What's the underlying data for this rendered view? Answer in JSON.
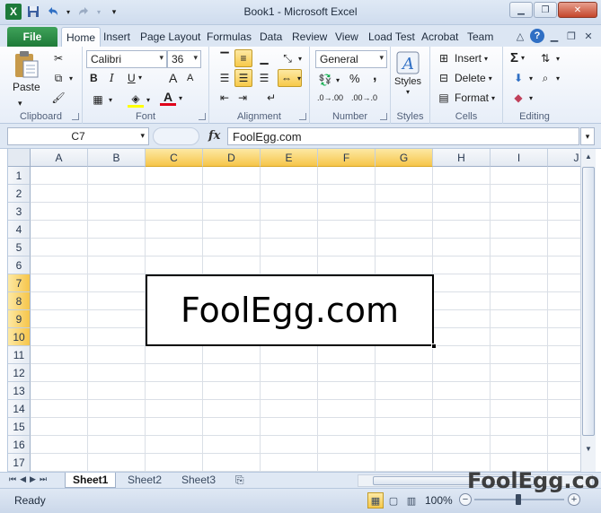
{
  "window": {
    "title": "Book1  -  Microsoft Excel"
  },
  "icons": {
    "app": "excel-icon",
    "save": "save-icon",
    "undo": "undo-icon",
    "redo": "redo-icon",
    "customize": "customize-qat-icon",
    "minimize": "minimize-icon",
    "restore": "restore-icon",
    "close": "close-icon",
    "help": "help-icon"
  },
  "qat": {
    "app_glyph": "X"
  },
  "ribbon_tabs": [
    "File",
    "Home",
    "Insert",
    "Page Layout",
    "Formulas",
    "Data",
    "Review",
    "View",
    "Load Test",
    "Acrobat",
    "Team"
  ],
  "active_tab": "Home",
  "groups": {
    "clipboard": {
      "label": "Clipboard",
      "paste": "Paste"
    },
    "font": {
      "label": "Font",
      "family": "Calibri",
      "size": "36",
      "bold": "B",
      "italic": "I",
      "underline": "U",
      "grow": "A",
      "shrink": "A",
      "color_glyph": "A"
    },
    "alignment": {
      "label": "Alignment"
    },
    "number": {
      "label": "Number",
      "format": "General",
      "percent": "%",
      "comma": ",",
      "inc_decimal": ".0→.00",
      "dec_decimal": ".00→.0"
    },
    "styles": {
      "label": "Styles",
      "button": "Styles"
    },
    "cells": {
      "label": "Cells",
      "insert": "Insert",
      "delete": "Delete",
      "format": "Format"
    },
    "editing": {
      "label": "Editing",
      "sum": "Σ"
    }
  },
  "formula_bar": {
    "name_box": "C7",
    "fx": "fx",
    "content": "FoolEgg.com"
  },
  "columns": [
    "A",
    "B",
    "C",
    "D",
    "E",
    "F",
    "G",
    "H",
    "I",
    "J"
  ],
  "selected_columns": [
    "C",
    "D",
    "E",
    "F",
    "G"
  ],
  "rows": [
    "1",
    "2",
    "3",
    "4",
    "5",
    "6",
    "7",
    "8",
    "9",
    "10",
    "11",
    "12",
    "13",
    "14",
    "15",
    "16",
    "17"
  ],
  "selected_rows": [
    "7",
    "8",
    "9",
    "10"
  ],
  "merged_cell": {
    "range": "C7:G10",
    "value": "FoolEgg.com"
  },
  "sheets": [
    "Sheet1",
    "Sheet2",
    "Sheet3"
  ],
  "active_sheet": "Sheet1",
  "status": {
    "mode": "Ready",
    "zoom": "100%",
    "zoom_minus": "−",
    "zoom_plus": "+"
  },
  "watermark": "FoolEgg.com",
  "colors": {
    "accent": "#f7c94a",
    "file_tab": "#1e7a38",
    "grid_line": "#dadfe6"
  }
}
